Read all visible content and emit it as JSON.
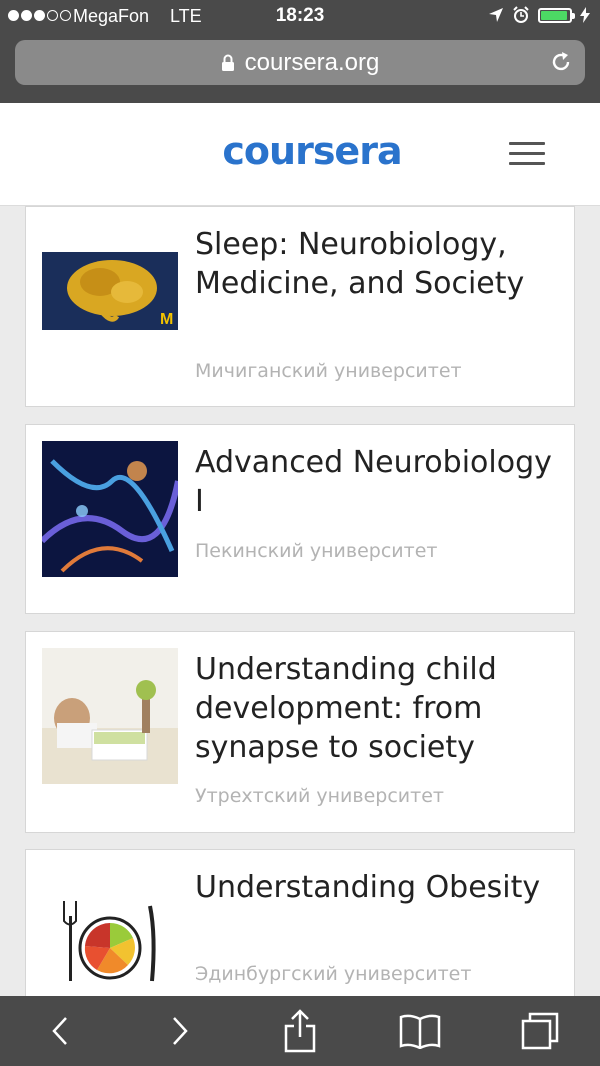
{
  "status_bar": {
    "carrier": "MegaFon",
    "network": "LTE",
    "time": "18:23"
  },
  "browser": {
    "url": "coursera.org"
  },
  "header": {
    "logo_text": "coursera",
    "brand_color": "#2a73cc"
  },
  "courses": [
    {
      "title": "Sleep: Neurobiology, Medicine, and Society",
      "org": "Мичиганский университет"
    },
    {
      "title": "Advanced Neurobiology I",
      "org": "Пекинский университет"
    },
    {
      "title": "Understanding child development: from synapse to society",
      "org": "Утрехтский университет"
    },
    {
      "title": "Understanding Obesity",
      "org": "Эдинбургский университет"
    }
  ],
  "toolbar": {
    "icons": [
      "back-icon",
      "forward-icon",
      "share-icon",
      "bookmarks-icon",
      "tabs-icon"
    ]
  }
}
